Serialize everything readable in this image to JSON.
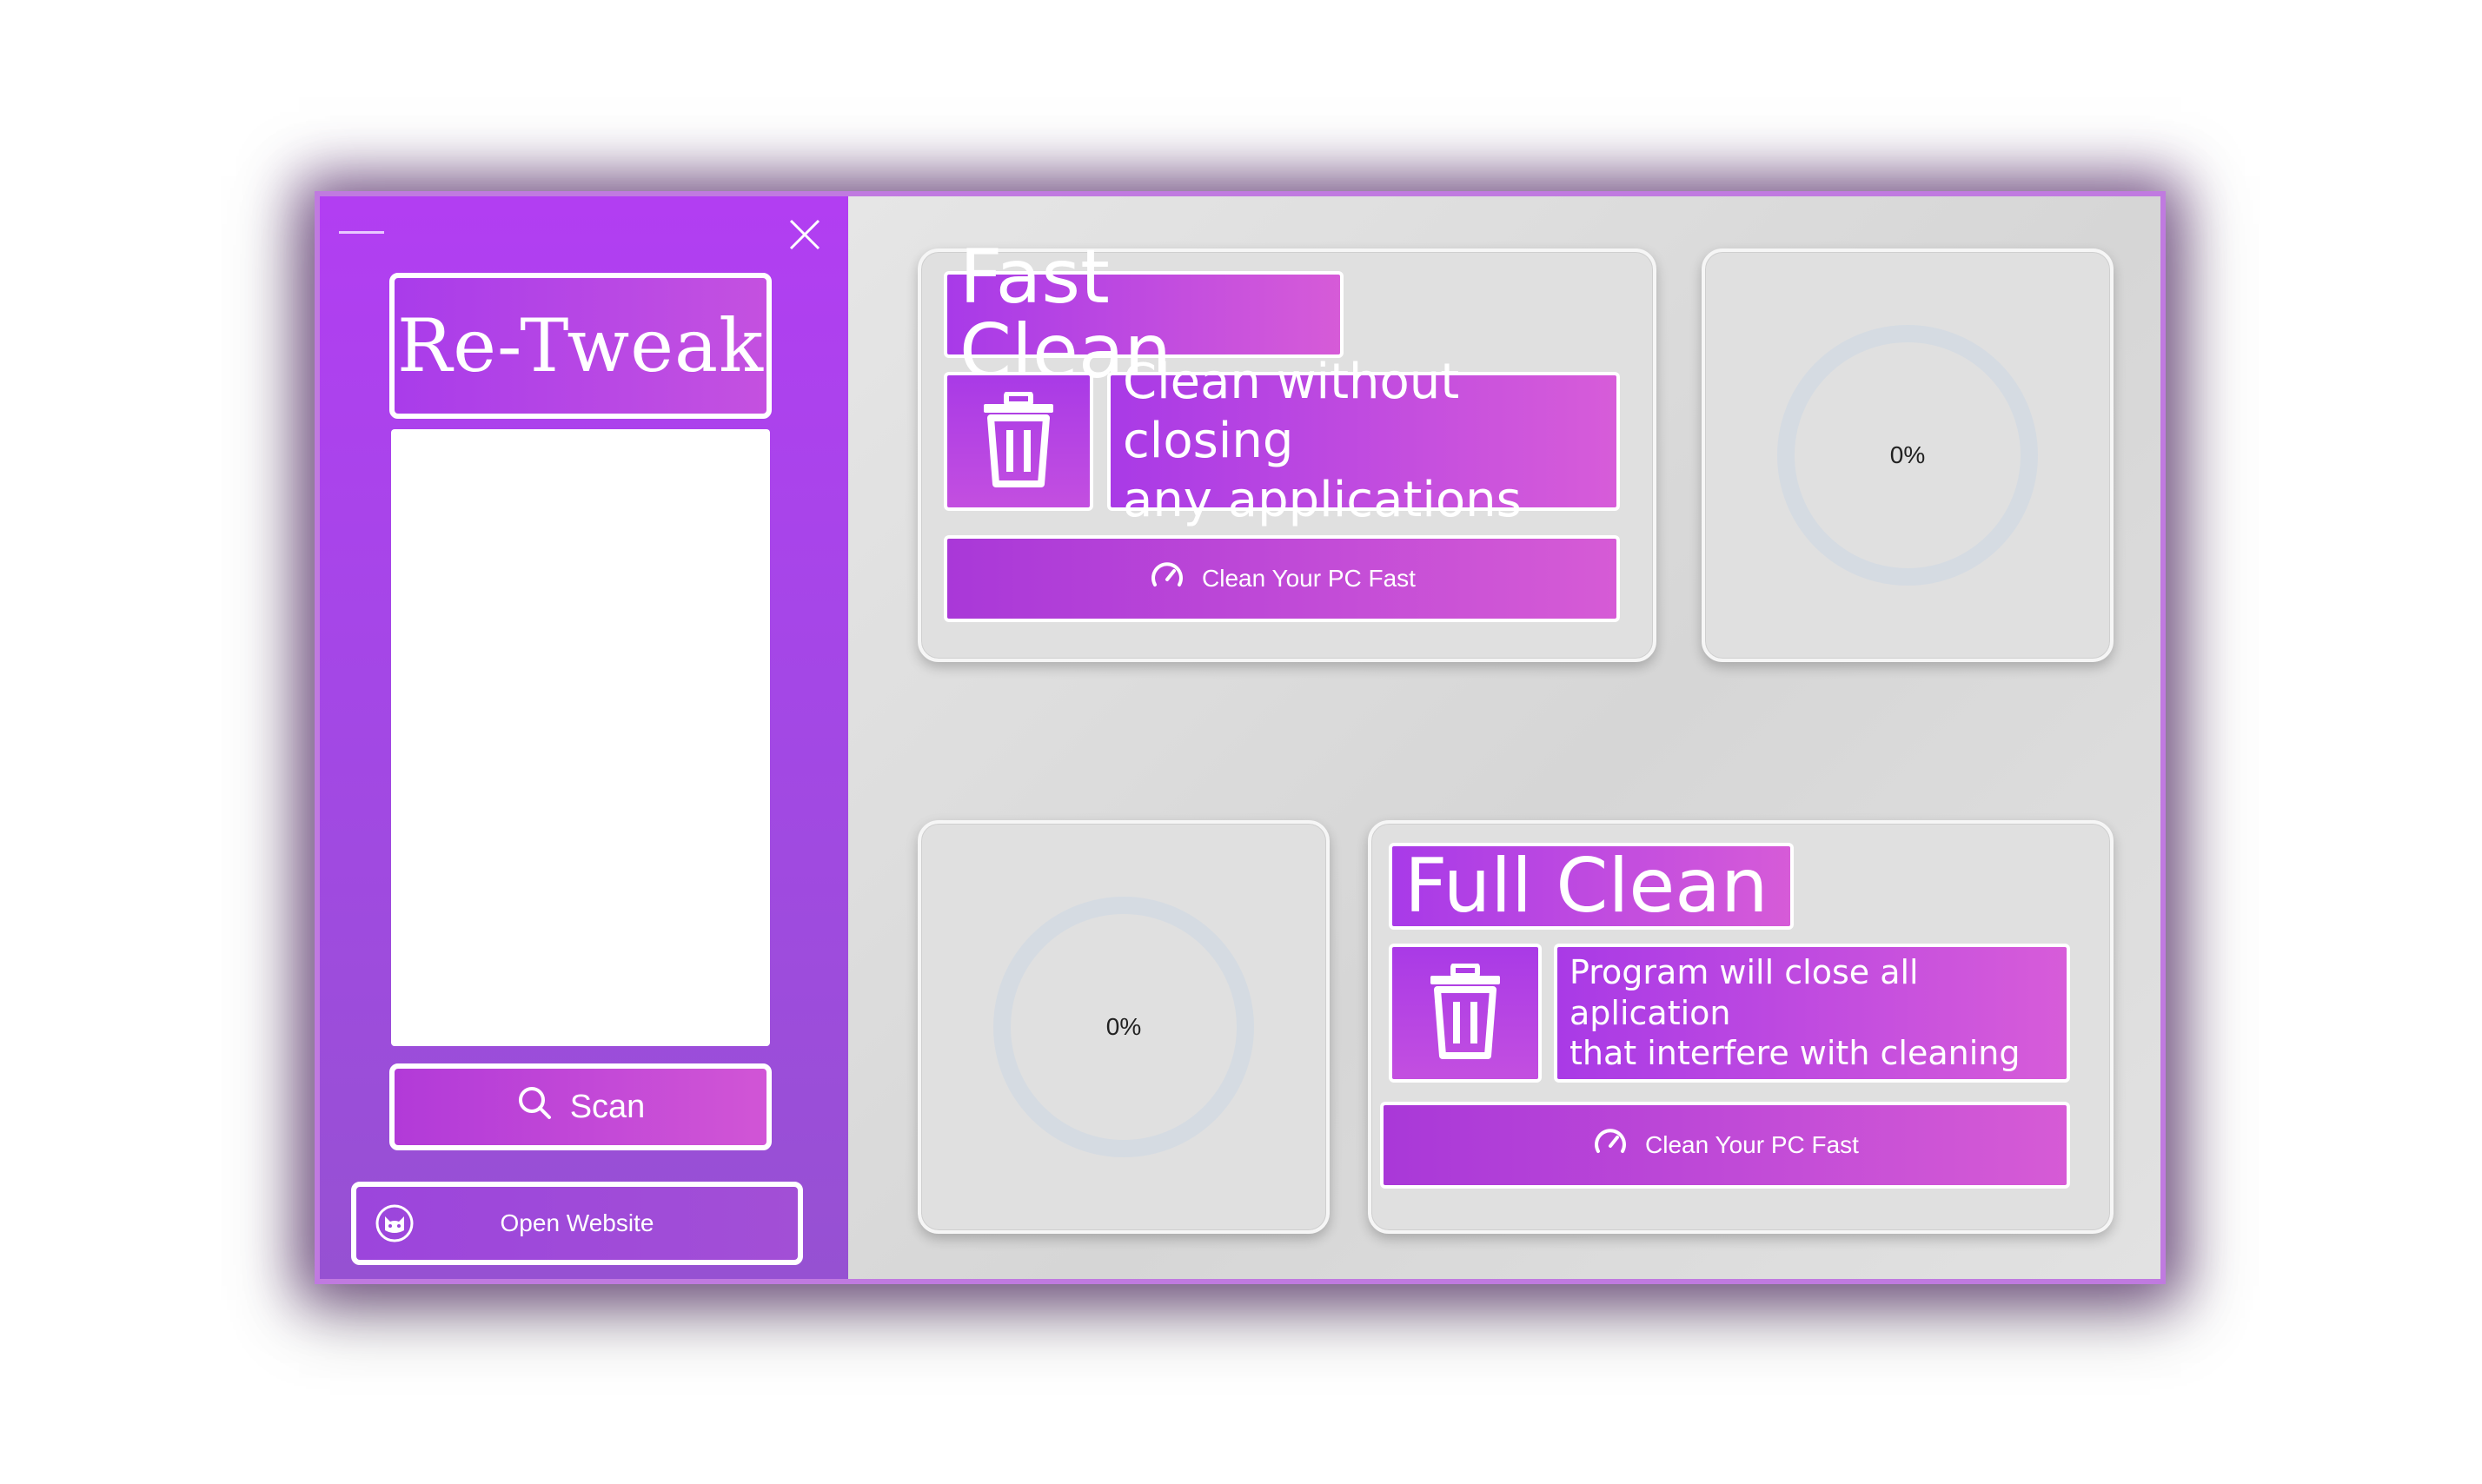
{
  "window": {
    "brand_title": "Re-Tweak"
  },
  "sidebar": {
    "scan_label": "Scan",
    "open_website_label": "Open Website"
  },
  "fast_clean": {
    "title": "Fast Clean",
    "description_line1": "Clean without closing",
    "description_line2": "any applications",
    "button_label": "Clean Your PC Fast",
    "progress_text": "0%",
    "progress": 0
  },
  "full_clean": {
    "title": "Full Clean",
    "description_line1": "Program will close all aplication",
    "description_line2": "that interfere with cleaning",
    "button_label": "Clean Your PC Fast",
    "progress_text": "0%",
    "progress": 0
  },
  "icons": {
    "close": "close-icon",
    "minimize": "minimize-icon",
    "search": "search-icon",
    "website": "cat-icon",
    "trash": "trash-icon",
    "speed": "speedometer-icon"
  },
  "colors": {
    "accent_start": "#a83ae8",
    "accent_end": "#d65bd8",
    "sidebar_top": "#b23ef2",
    "sidebar_bottom": "#9651d2",
    "gauge_track": "#d5dbe2"
  }
}
